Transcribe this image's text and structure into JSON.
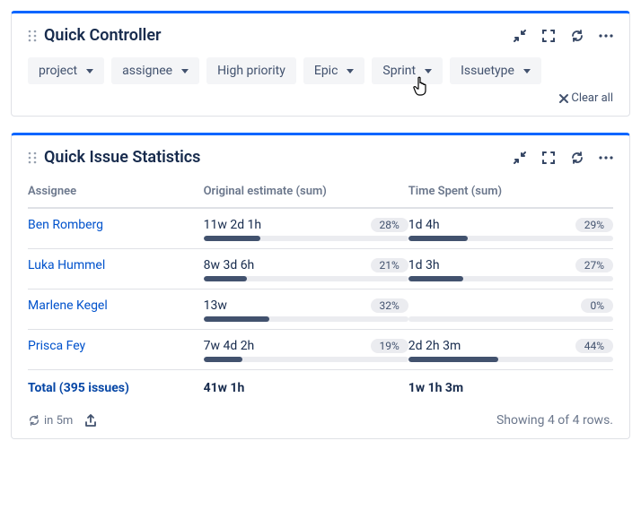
{
  "controller": {
    "title": "Quick Controller",
    "filters": {
      "project": "project",
      "assignee": "assignee",
      "high_priority": "High priority",
      "epic": "Epic",
      "sprint": "Sprint",
      "issuetype": "Issuetype"
    },
    "clear_all": "Clear all"
  },
  "stats": {
    "title": "Quick Issue Statistics",
    "columns": {
      "assignee": "Assignee",
      "original": "Original estimate (sum)",
      "spent": "Time Spent (sum)"
    },
    "rows": [
      {
        "assignee": "Ben Romberg",
        "original_val": "11w 2d 1h",
        "original_pct": "28%",
        "original_w": 28,
        "spent_val": "1d 4h",
        "spent_pct": "29%",
        "spent_w": 29
      },
      {
        "assignee": "Luka Hummel",
        "original_val": "8w 3d 6h",
        "original_pct": "21%",
        "original_w": 21,
        "spent_val": "1d 3h",
        "spent_pct": "27%",
        "spent_w": 27
      },
      {
        "assignee": "Marlene Kegel",
        "original_val": "13w",
        "original_pct": "32%",
        "original_w": 32,
        "spent_val": "",
        "spent_pct": "0%",
        "spent_w": 0
      },
      {
        "assignee": "Prisca Fey",
        "original_val": "7w 4d 2h",
        "original_pct": "19%",
        "original_w": 19,
        "spent_val": "2d 2h 3m",
        "spent_pct": "44%",
        "spent_w": 44
      }
    ],
    "total": {
      "label": "Total (395 issues)",
      "original": "41w 1h",
      "spent": "1w 1h 3m"
    },
    "footer": {
      "refresh_in": "in 5m",
      "showing": "Showing 4 of 4 rows."
    }
  }
}
